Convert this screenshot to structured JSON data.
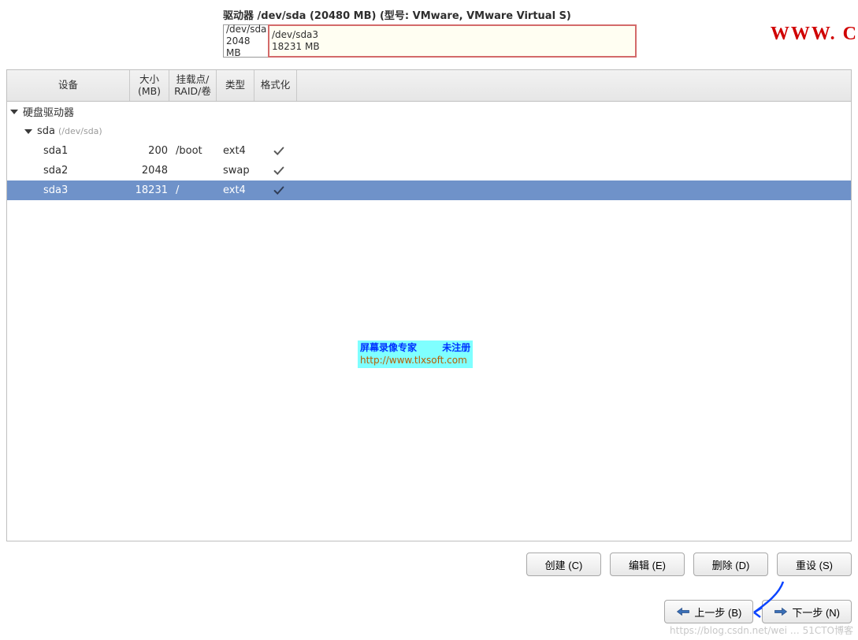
{
  "drive": {
    "title": "驱动器 /dev/sda (20480 MB) (型号: VMware, VMware Virtual S)",
    "segments": [
      {
        "name": "/dev/sda",
        "size": "2048 MB"
      },
      {
        "name": "/dev/sda3",
        "size": "18231 MB"
      }
    ]
  },
  "watermark_right": "WWW. C",
  "columns": {
    "device": "设备",
    "size": "大小\n(MB)",
    "mount": "挂载点/\nRAID/卷",
    "type": "类型",
    "format": "格式化"
  },
  "tree": {
    "root_label": "硬盘驱动器",
    "disk": {
      "name": "sda",
      "path": "(/dev/sda)"
    },
    "parts": [
      {
        "dev": "sda1",
        "size": "200",
        "mount": "/boot",
        "type": "ext4",
        "format": true,
        "selected": false
      },
      {
        "dev": "sda2",
        "size": "2048",
        "mount": "",
        "type": "swap",
        "format": true,
        "selected": false
      },
      {
        "dev": "sda3",
        "size": "18231",
        "mount": "/",
        "type": "ext4",
        "format": true,
        "selected": true
      }
    ]
  },
  "overlay": {
    "line1_left": "屏幕录像专家",
    "line1_right": "未注册",
    "line2": "http://www.tlxsoft.com"
  },
  "buttons": {
    "create": "创建 (C)",
    "edit": "编辑 (E)",
    "delete": "删除 (D)",
    "reset": "重设 (S)",
    "back": "上一步 (B)",
    "next": "下一步 (N)"
  },
  "footer_watermark": "https://blog.csdn.net/wei … 51CTO博客"
}
